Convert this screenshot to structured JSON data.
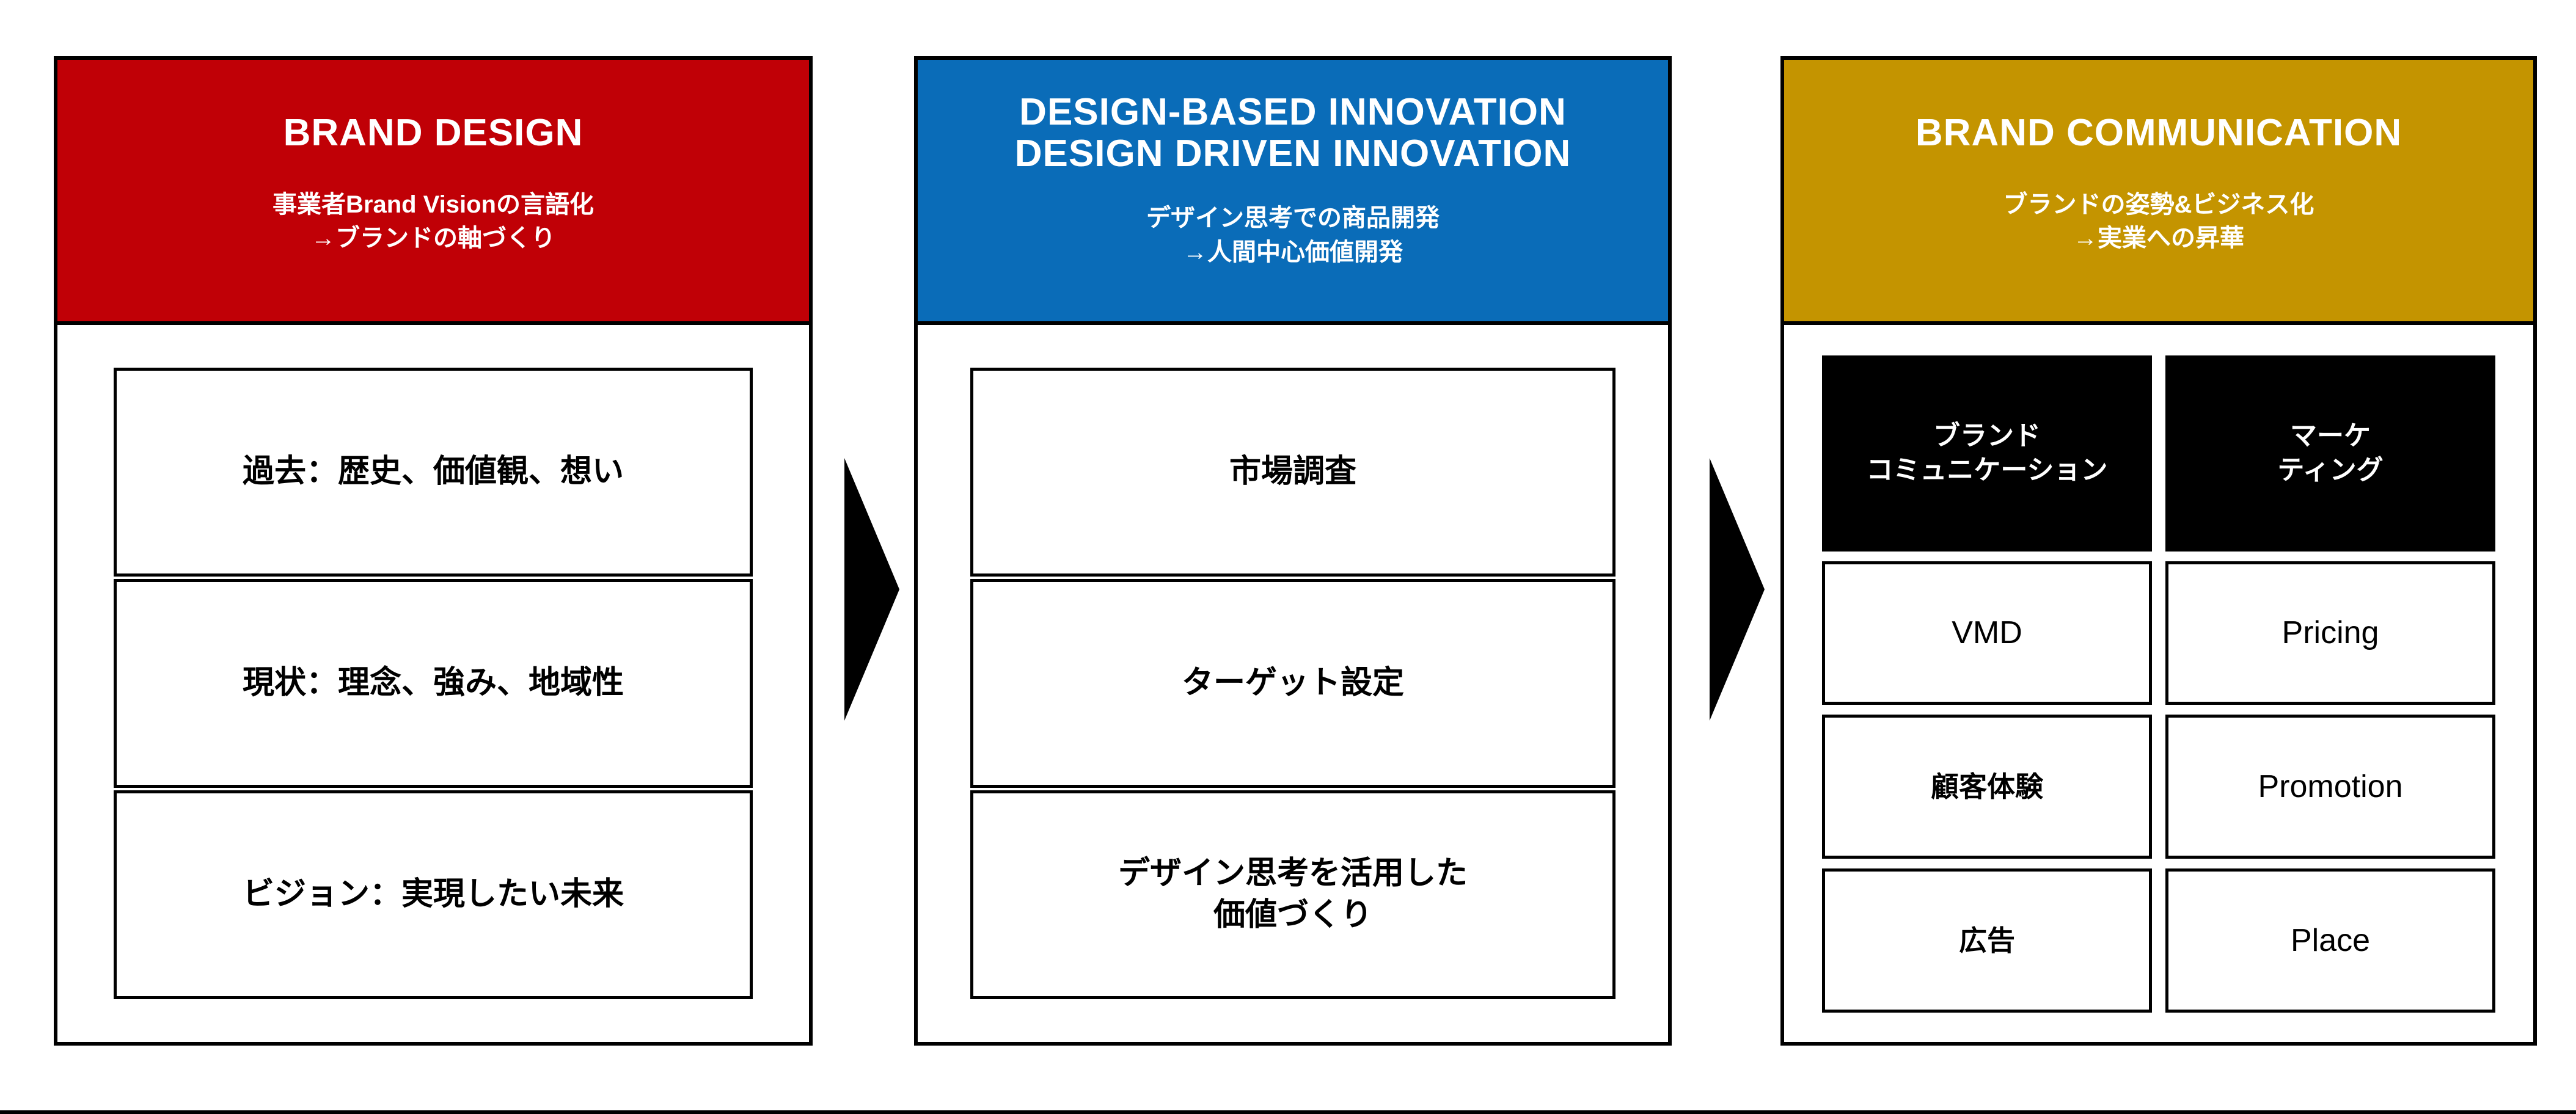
{
  "diagram": {
    "columns": [
      {
        "id": "brand-design",
        "accent_color": "#C00006",
        "title": "BRAND DESIGN",
        "subtitle": "事業者Brand Visionの言語化\n→ブランドの軸づくり",
        "items": [
          "過去：歴史、価値観、想い",
          "現状：理念、強み、地域性",
          "ビジョン：実現したい未来"
        ]
      },
      {
        "id": "innovation",
        "accent_color": "#0A6CB8",
        "title": "DESIGN-BASED INNOVATION\nDESIGN DRIVEN INNOVATION",
        "subtitle": "デザイン思考での商品開発\n→人間中心価値開発",
        "items": [
          "市場調査",
          "ターゲット設定",
          "デザイン思考を活用した\n価値づくり"
        ]
      },
      {
        "id": "communication",
        "accent_color": "#C49400",
        "title": "BRAND COMMUNICATION",
        "subtitle": "ブランドの姿勢&ビジネス化\n→実業への昇華",
        "grid": [
          {
            "label": "ブランド\nコミュニケーション",
            "style": "dark"
          },
          {
            "label": "マーケ\nティング",
            "style": "dark"
          },
          {
            "label": "VMD",
            "style": "latin"
          },
          {
            "label": "Pricing",
            "style": "latin"
          },
          {
            "label": "顧客体験",
            "style": "plain"
          },
          {
            "label": "Promotion",
            "style": "latin"
          },
          {
            "label": "広告",
            "style": "plain"
          },
          {
            "label": "Place",
            "style": "latin"
          }
        ]
      }
    ],
    "arrows": [
      {
        "name": "arrow-brand-design-to-innovation",
        "direction": "right"
      },
      {
        "name": "arrow-innovation-to-communication",
        "direction": "right"
      }
    ]
  }
}
